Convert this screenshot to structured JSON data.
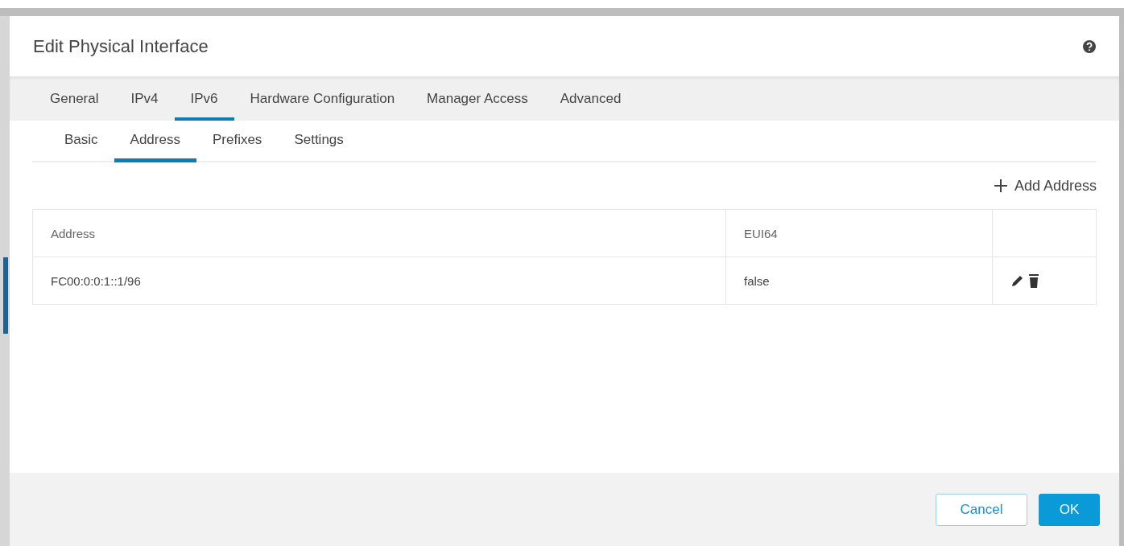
{
  "dialog": {
    "title": "Edit Physical Interface"
  },
  "tabs": [
    {
      "label": "General",
      "selected": false
    },
    {
      "label": "IPv4",
      "selected": false
    },
    {
      "label": "IPv6",
      "selected": true
    },
    {
      "label": "Hardware Configuration",
      "selected": false
    },
    {
      "label": "Manager Access",
      "selected": false
    },
    {
      "label": "Advanced",
      "selected": false
    }
  ],
  "subtabs": [
    {
      "label": "Basic",
      "selected": false
    },
    {
      "label": "Address",
      "selected": true
    },
    {
      "label": "Prefixes",
      "selected": false
    },
    {
      "label": "Settings",
      "selected": false
    }
  ],
  "add_button": "Add Address",
  "table": {
    "columns": [
      "Address",
      "EUI64"
    ],
    "rows": [
      {
        "cells": [
          "FC00:0:0:1::1/96",
          "false"
        ]
      }
    ]
  },
  "buttons": [
    {
      "label": "Cancel",
      "kind": "secondary"
    },
    {
      "label": "OK",
      "kind": "primary"
    }
  ]
}
